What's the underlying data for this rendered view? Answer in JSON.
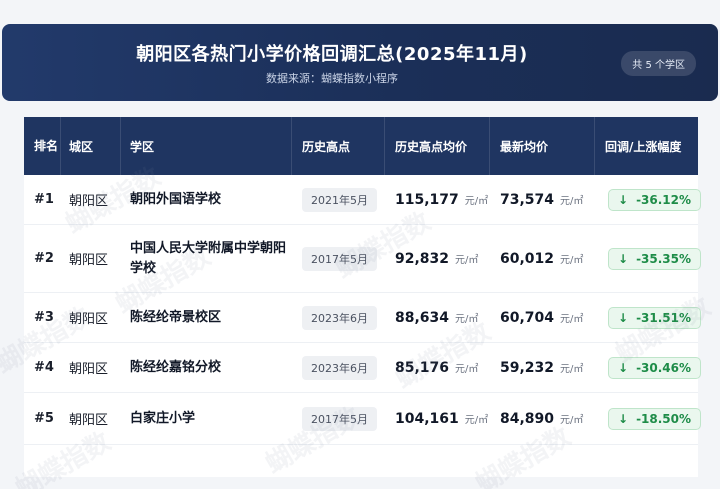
{
  "header": {
    "title": "朝阳区各热门小学价格回调汇总(2025年11月)",
    "subtitle": "数据来源：蝴蝶指数小程序",
    "count_badge": "共 5 个学区"
  },
  "table": {
    "columns": [
      "排名",
      "城区",
      "学区",
      "历史高点",
      "历史高点均价",
      "最新均价",
      "回调/上涨幅度"
    ],
    "unit": "元/㎡",
    "rows": [
      {
        "rank": "#1",
        "district": "朝阳区",
        "school": "朝阳外国语学校",
        "peak_date": "2021年5月",
        "peak_price": "115,177",
        "latest_price": "73,574",
        "change": "-36.12%"
      },
      {
        "rank": "#2",
        "district": "朝阳区",
        "school": "中国人民大学附属中学朝阳学校",
        "peak_date": "2017年5月",
        "peak_price": "92,832",
        "latest_price": "60,012",
        "change": "-35.35%"
      },
      {
        "rank": "#3",
        "district": "朝阳区",
        "school": "陈经纶帝景校区",
        "peak_date": "2023年6月",
        "peak_price": "88,634",
        "latest_price": "60,704",
        "change": "-31.51%"
      },
      {
        "rank": "#4",
        "district": "朝阳区",
        "school": "陈经纶嘉铭分校",
        "peak_date": "2023年6月",
        "peak_price": "85,176",
        "latest_price": "59,232",
        "change": "-30.46%"
      },
      {
        "rank": "#5",
        "district": "朝阳区",
        "school": "白家庄小学",
        "peak_date": "2017年5月",
        "peak_price": "104,161",
        "latest_price": "84,890",
        "change": "-18.50%"
      }
    ]
  },
  "watermark": "蝴蝶指数",
  "icons": {
    "change_arrow": "arrow-down-icon"
  },
  "colors": {
    "header_bg": "#1f3561",
    "change_green": "#1e8c48",
    "change_bg": "#eaf7ee"
  }
}
